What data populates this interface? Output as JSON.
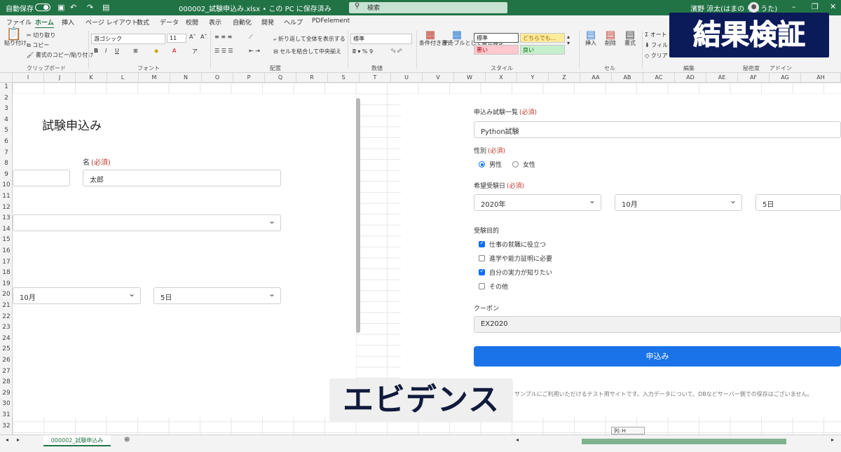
{
  "titlebar": {
    "autosave": "自動保存",
    "autosave_state": "オフ",
    "filename": "000002_試験申込み.xlsx • この PC に保存済み",
    "search_placeholder": "検索",
    "user": "濱野 涼太(はまの りょうた)"
  },
  "menu": [
    "ファイル",
    "ホーム",
    "挿入",
    "ページ レイアウト",
    "数式",
    "データ",
    "校閲",
    "表示",
    "自動化",
    "開発",
    "ヘルプ",
    "PDFelement"
  ],
  "ribbon": {
    "clipboard": {
      "paste": "貼り付け",
      "cut": "切り取り",
      "copy": "コピー",
      "format_painter": "書式のコピー/貼り付け",
      "group": "クリップボード"
    },
    "font": {
      "name": "游ゴシック",
      "size": "11",
      "group": "フォント"
    },
    "alignment": {
      "wrap": "折り返して全体を表示する",
      "merge": "セルを結合して中央揃え",
      "group": "配置"
    },
    "number": {
      "format": "標準",
      "group": "数値"
    },
    "styles": {
      "cond": "条件付き書式",
      "table": "テーブルとして書式設定",
      "standard": "標準",
      "neutral": "どちらでも...",
      "bad": "悪い",
      "good": "良い",
      "group": "スタイル"
    },
    "cells": {
      "insert": "挿入",
      "delete": "削除",
      "format": "書式",
      "group": "セル"
    },
    "editing": {
      "autosum": "オート S",
      "fill": "フィル",
      "clear": "クリア",
      "group": "編集"
    },
    "sensitivity": "秘密度",
    "addin": "アドイン"
  },
  "columns": [
    "I",
    "J",
    "K",
    "L",
    "M",
    "N",
    "O",
    "P",
    "Q",
    "R",
    "S",
    "T",
    "U",
    "V",
    "W",
    "X",
    "Y",
    "Z",
    "AA",
    "AB",
    "AC",
    "AD",
    "AE",
    "AF",
    "AG",
    "AH"
  ],
  "rows": [
    "1",
    "2",
    "3",
    "4",
    "5",
    "6",
    "7",
    "8",
    "9",
    "10",
    "11",
    "12",
    "13",
    "14",
    "15",
    "16",
    "17",
    "18",
    "19",
    "20",
    "21",
    "22",
    "23",
    "24",
    "25",
    "26",
    "27",
    "28",
    "29",
    "30",
    "31",
    "32"
  ],
  "left_form": {
    "title": "試験申込み",
    "first_name_label": "名",
    "required": "(必須)",
    "first_name_value": "太郎",
    "month_value": "10月",
    "day_value": "5日"
  },
  "right_form": {
    "exam_label": "申込み試験一覧",
    "exam_value": "Python試験",
    "gender_label": "性別",
    "gender_options": [
      "男性",
      "女性"
    ],
    "date_label": "希望受験日",
    "year_value": "2020年",
    "month_value": "10月",
    "day_value": "5日",
    "purpose_label": "受験目的",
    "purposes": [
      {
        "label": "仕事の就職に役立つ",
        "checked": true
      },
      {
        "label": "進学や能力証明に必要",
        "checked": false
      },
      {
        "label": "自分の実力が知りたい",
        "checked": true
      },
      {
        "label": "その他",
        "checked": false
      }
    ],
    "coupon_label": "クーポン",
    "coupon_value": "EX2020",
    "submit": "申込み",
    "footnote": "サンプルにご利用いただけるテスト用サイトです。入力データについて、DBなどサーバー側での保存はございません。"
  },
  "overlay": {
    "corner_title": "結果検証",
    "caption": "エビデンス"
  },
  "sheet_tab": "000002_試験申込み",
  "tooltip": "列: H"
}
